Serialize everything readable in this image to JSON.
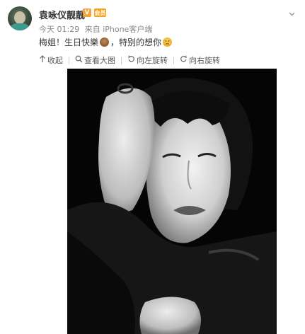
{
  "post": {
    "username": "袁咏仪靓靓",
    "badge_v": "V",
    "badge_vip": "会员",
    "time": "今天 01:29",
    "source": "来自 iPhone客户端",
    "text_part1": "梅姐！生日快樂",
    "text_part2": "，特别的想你",
    "emoji_1": "cake-emoji",
    "emoji_2": "sad-face-emoji"
  },
  "toolbar": {
    "collapse": "收起",
    "view_large": "查看大图",
    "rotate_left": "向左旋转",
    "rotate_right": "向右旋转"
  },
  "icons": {
    "menu": "chevron-down-icon",
    "collapse": "arrow-up-icon",
    "view_large": "magnifier-icon",
    "rotate_left": "rotate-left-icon",
    "rotate_right": "rotate-right-icon"
  },
  "colors": {
    "name": "#333333",
    "meta": "#888888",
    "badge_v": "#f0a63c",
    "badge_vip": "#f7a21b"
  }
}
